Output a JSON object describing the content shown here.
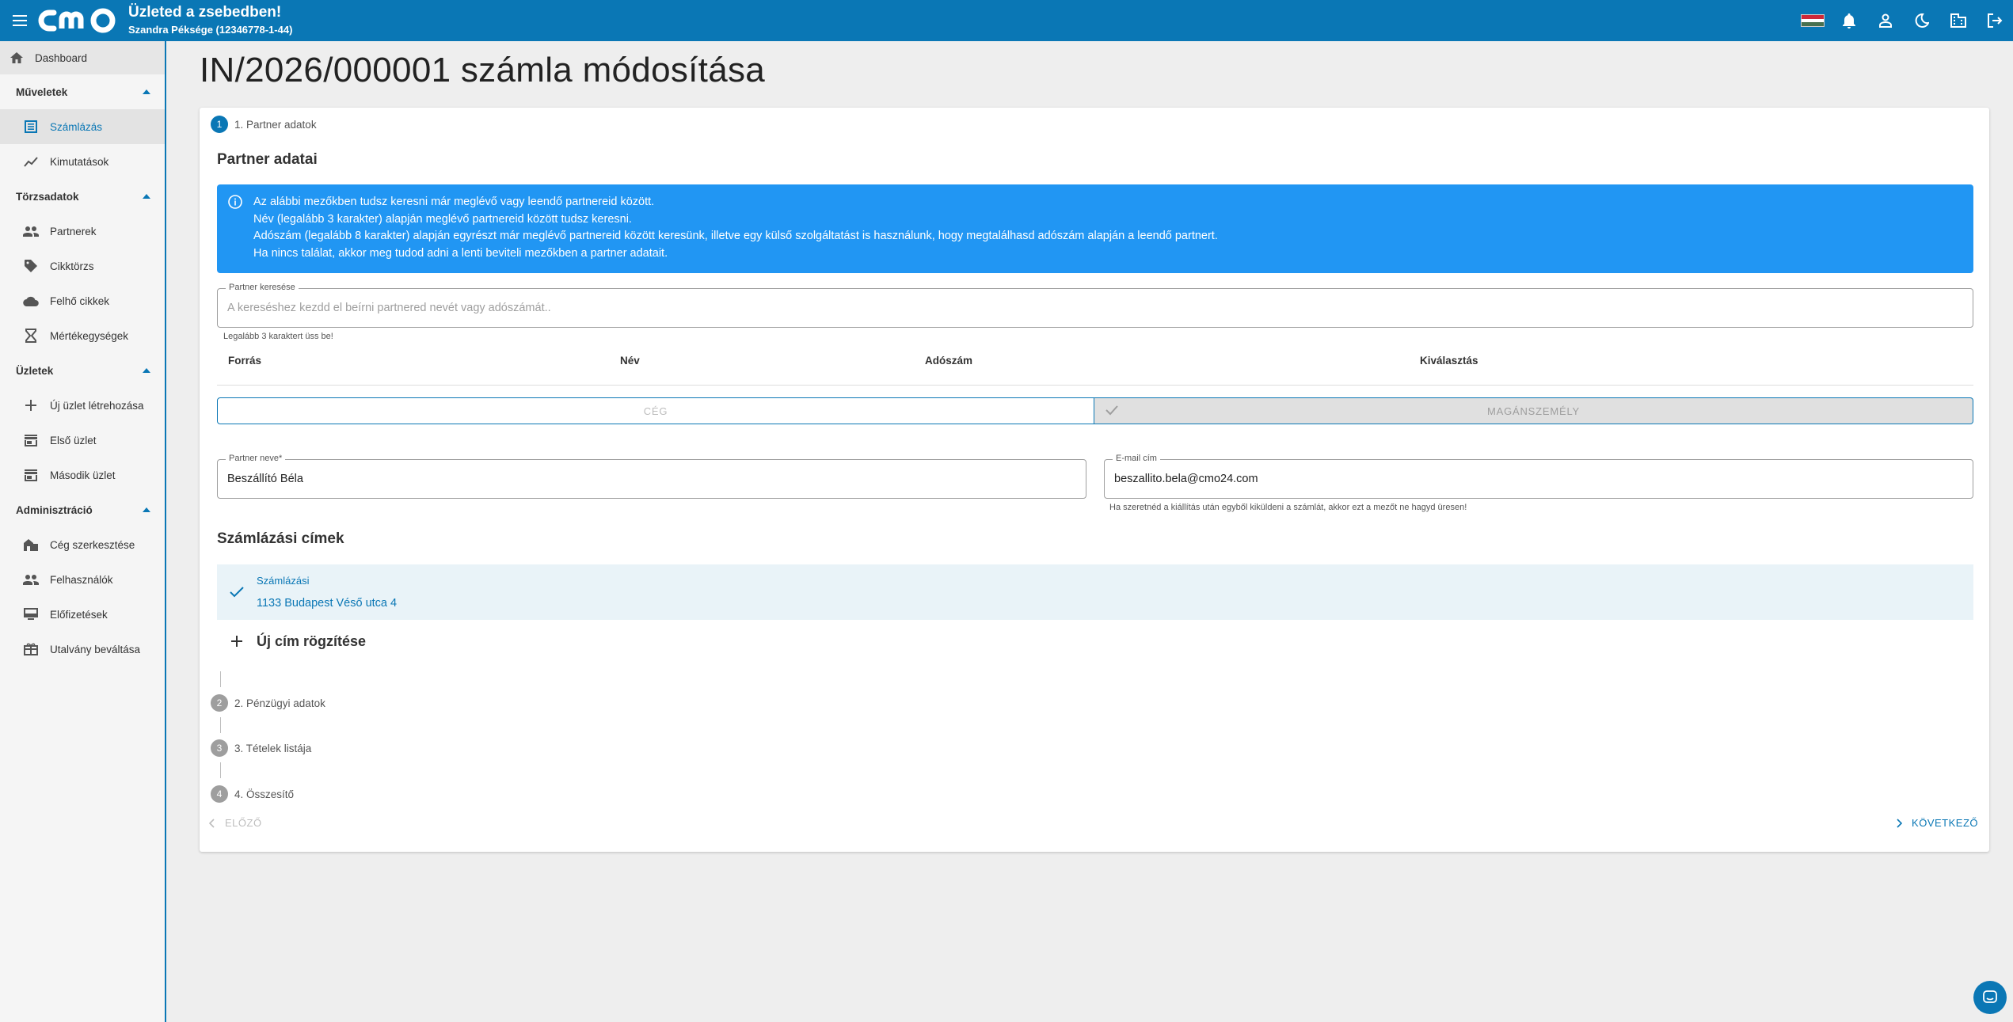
{
  "header": {
    "title": "Üzleted a zsebedben!",
    "subtitle": "Szandra Péksége (12346778-1-44)",
    "brand_color": "#0a77b5",
    "icons": [
      "hungarian-flag-icon",
      "bell-icon",
      "account-icon",
      "dark-mode-icon",
      "business-icon",
      "logout-icon"
    ]
  },
  "sidebar": {
    "dashboard": "Dashboard",
    "sections": [
      {
        "label": "Műveletek",
        "items": [
          "Számlázás",
          "Kimutatások"
        ]
      },
      {
        "label": "Törzsadatok",
        "items": [
          "Partnerek",
          "Cikktörzs",
          "Felhő cikkek",
          "Mértékegységek"
        ]
      },
      {
        "label": "Üzletek",
        "items": [
          "Új üzlet létrehozása",
          "Első üzlet",
          "Második üzlet"
        ]
      },
      {
        "label": "Adminisztráció",
        "items": [
          "Cég szerkesztése",
          "Felhasználók",
          "Előfizetések",
          "Utalvány beváltása"
        ]
      }
    ],
    "active_item": "Számlázás"
  },
  "page": {
    "title": "IN/2026/000001 számla módosítása"
  },
  "steps": [
    {
      "num": "1",
      "label": "1. Partner adatok",
      "active": true
    },
    {
      "num": "2",
      "label": "2. Pénzügyi adatok",
      "active": false
    },
    {
      "num": "3",
      "label": "3. Tételek listája",
      "active": false
    },
    {
      "num": "4",
      "label": "4. Összesítő",
      "active": false
    }
  ],
  "partner": {
    "heading": "Partner adatai",
    "info_lines": [
      "Az alábbi mezőkben tudsz keresni már meglévő vagy leendő partnereid között.",
      "Név (legalább 3 karakter) alapján meglévő partnereid között tudsz keresni.",
      "Adószám (legalább 8 karakter) alapján egyrészt már meglévő partnereid között keresünk, illetve egy külső szolgáltatást is használunk, hogy megtalálhasd adószám alapján a leendő partnert.",
      "Ha nincs találat, akkor meg tudod adni a lenti beviteli mezőkben a partner adatait."
    ],
    "search": {
      "label": "Partner keresése",
      "placeholder": "A kereséshez kezdd el beírni partnered nevét vagy adószámát..",
      "hint": "Legalább 3 karaktert üss be!"
    },
    "table_headers": [
      "Forrás",
      "Név",
      "Adószám",
      "Kiválasztás"
    ],
    "type_toggle": {
      "company": "CÉG",
      "individual": "MAGÁNSZEMÉLY",
      "selected": "individual"
    },
    "name_field": {
      "label": "Partner neve*",
      "value": "Beszállító Béla"
    },
    "email_field": {
      "label": "E-mail cím",
      "value": "beszallito.bela@cmo24.com",
      "hint": "Ha szeretnéd a kiállítás után egyből kiküldeni a számlát, akkor ezt a mezőt ne hagyd üresen!"
    }
  },
  "billing": {
    "heading": "Számlázási címek",
    "address_type": "Számlázási",
    "address": "1133 Budapest Véső utca 4",
    "new_address": "Új cím rögzítése"
  },
  "nav": {
    "prev": "ELŐZŐ",
    "next": "KÖVETKEZŐ"
  }
}
